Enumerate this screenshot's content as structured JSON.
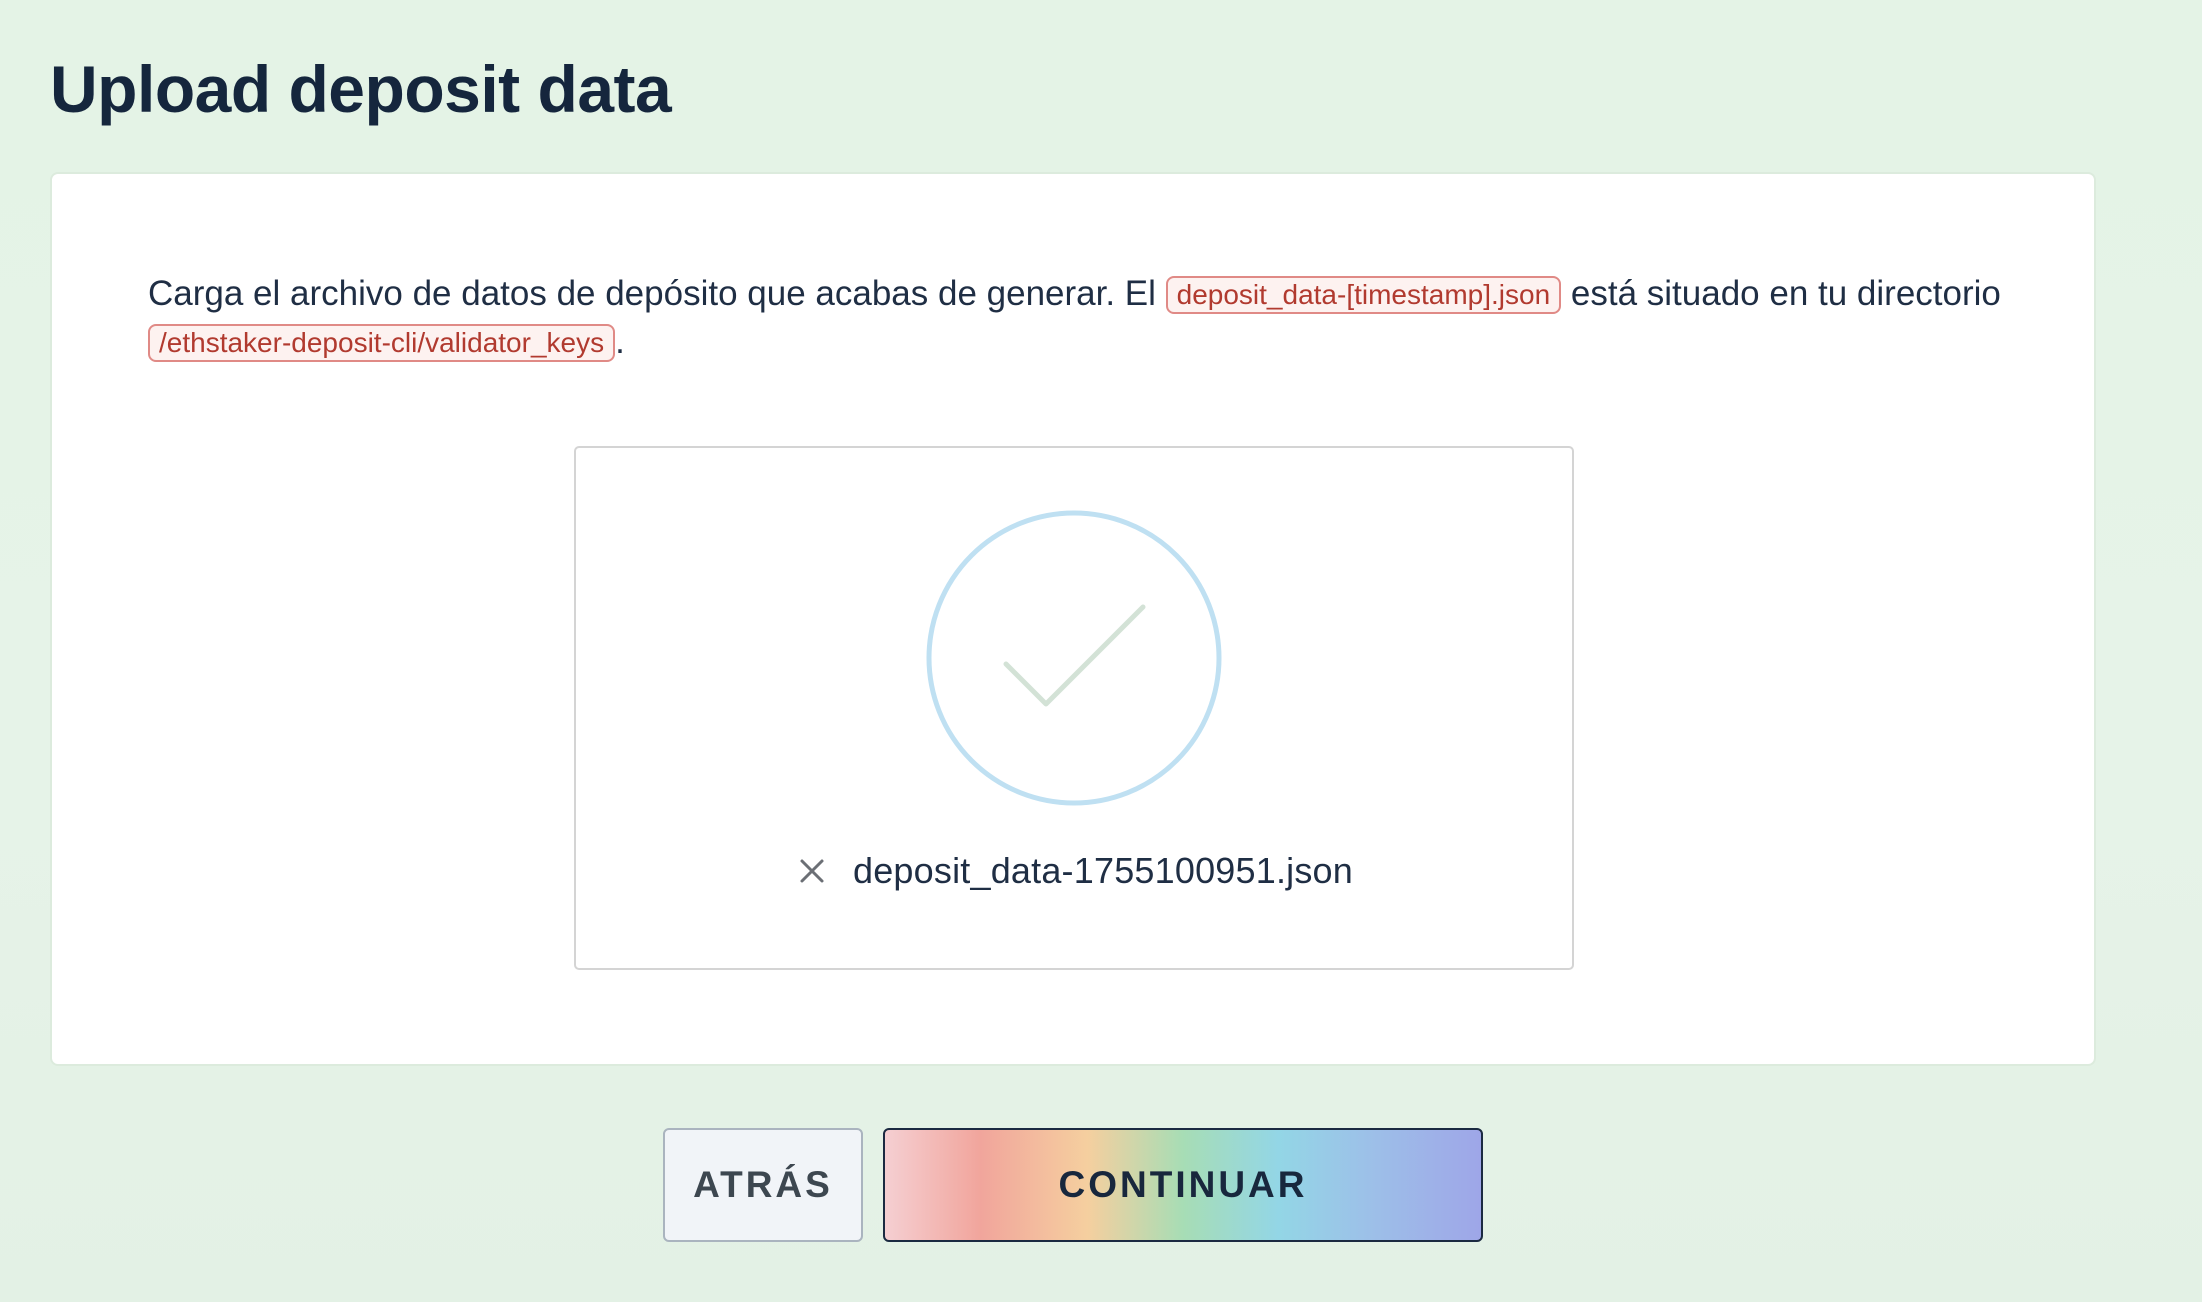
{
  "page": {
    "title": "Upload deposit data"
  },
  "instructions": {
    "part1": "Carga el archivo de datos de depósito que acabas de generar. El ",
    "code_file": "deposit_data-[timestamp].json",
    "part2": " está situado en tu directorio ",
    "code_dir": "/ethstaker-deposit-cli/validator_keys",
    "part3": "."
  },
  "upload": {
    "status_icon": "check-circle-icon",
    "remove_icon": "close-icon",
    "file_name": "deposit_data-1755100951.json"
  },
  "buttons": {
    "back_label": "ATRÁS",
    "continue_label": "CONTINUAR"
  },
  "colors": {
    "circle": "#bfe0f2",
    "check": "#d3e2d6",
    "code_text": "#b13a2f",
    "code_border": "#e08a86"
  }
}
